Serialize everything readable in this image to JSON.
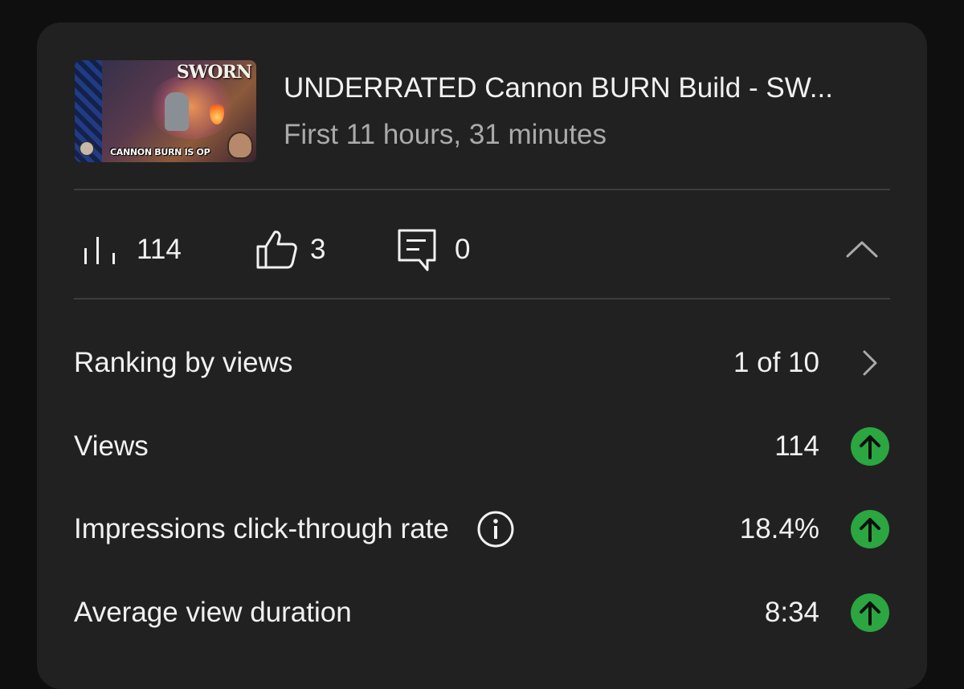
{
  "video": {
    "title": "UNDERRATED Cannon BURN Build - SW...",
    "subtitle": "First 11 hours, 31 minutes",
    "thumbnail": {
      "logo_text": "SWORN",
      "caption": "CANNON BURN IS OP"
    }
  },
  "stats": {
    "views": "114",
    "likes": "3",
    "comments": "0",
    "views_icon": "bar-chart-icon",
    "likes_icon": "thumbs-up-icon",
    "comments_icon": "comment-icon",
    "collapse_icon": "chevron-up-icon"
  },
  "metrics": [
    {
      "label": "Ranking by views",
      "value": "1 of 10",
      "trail_icon": "chevron-right-icon"
    },
    {
      "label": "Views",
      "value": "114",
      "trail_icon": "trend-up-icon"
    },
    {
      "label": "Impressions click-through rate",
      "value": "18.4%",
      "trail_icon": "trend-up-icon",
      "info_icon": "info-icon"
    },
    {
      "label": "Average view duration",
      "value": "8:34",
      "trail_icon": "trend-up-icon"
    }
  ],
  "colors": {
    "background": "#0f0f0f",
    "card": "#212121",
    "text_primary": "#f1f1f1",
    "text_secondary": "#aaaaaa",
    "trend_up": "#2ba640"
  }
}
